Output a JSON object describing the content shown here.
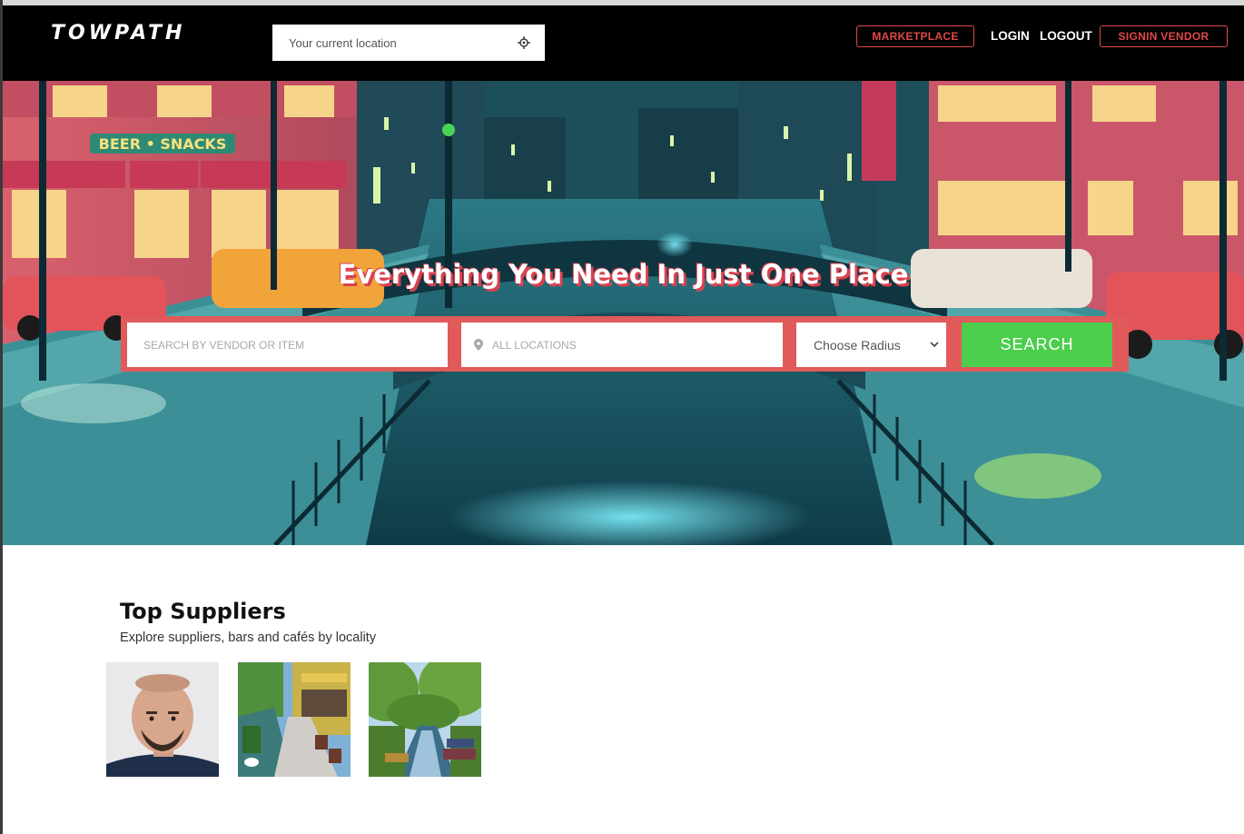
{
  "header": {
    "logo_text": "TOWPATH",
    "location_placeholder": "Your current location",
    "nav": {
      "marketplace": "MARKETPLACE",
      "login": "LOGIN",
      "logout": "LOGOUT",
      "signin_vendor": "SIGNIN VENDOR"
    }
  },
  "hero": {
    "headline": "Everything You Need In Just One Place",
    "sign_text": "BEER • SNACKS",
    "search": {
      "vendor_placeholder": "SEARCH BY VENDOR OR ITEM",
      "location_placeholder": "ALL LOCATIONS",
      "radius_selected": "Choose Radius",
      "button_label": "SEARCH"
    }
  },
  "suppliers": {
    "title": "Top Suppliers",
    "subtitle": "Explore suppliers, bars and cafés by locality",
    "cards": [
      {
        "image": "portrait-photo"
      },
      {
        "image": "canal-street-cafe-photo"
      },
      {
        "image": "canal-boats-photo"
      }
    ]
  },
  "colors": {
    "accent_red": "#e04848",
    "search_green": "#4cce4c",
    "navbar_bg": "#000000"
  }
}
